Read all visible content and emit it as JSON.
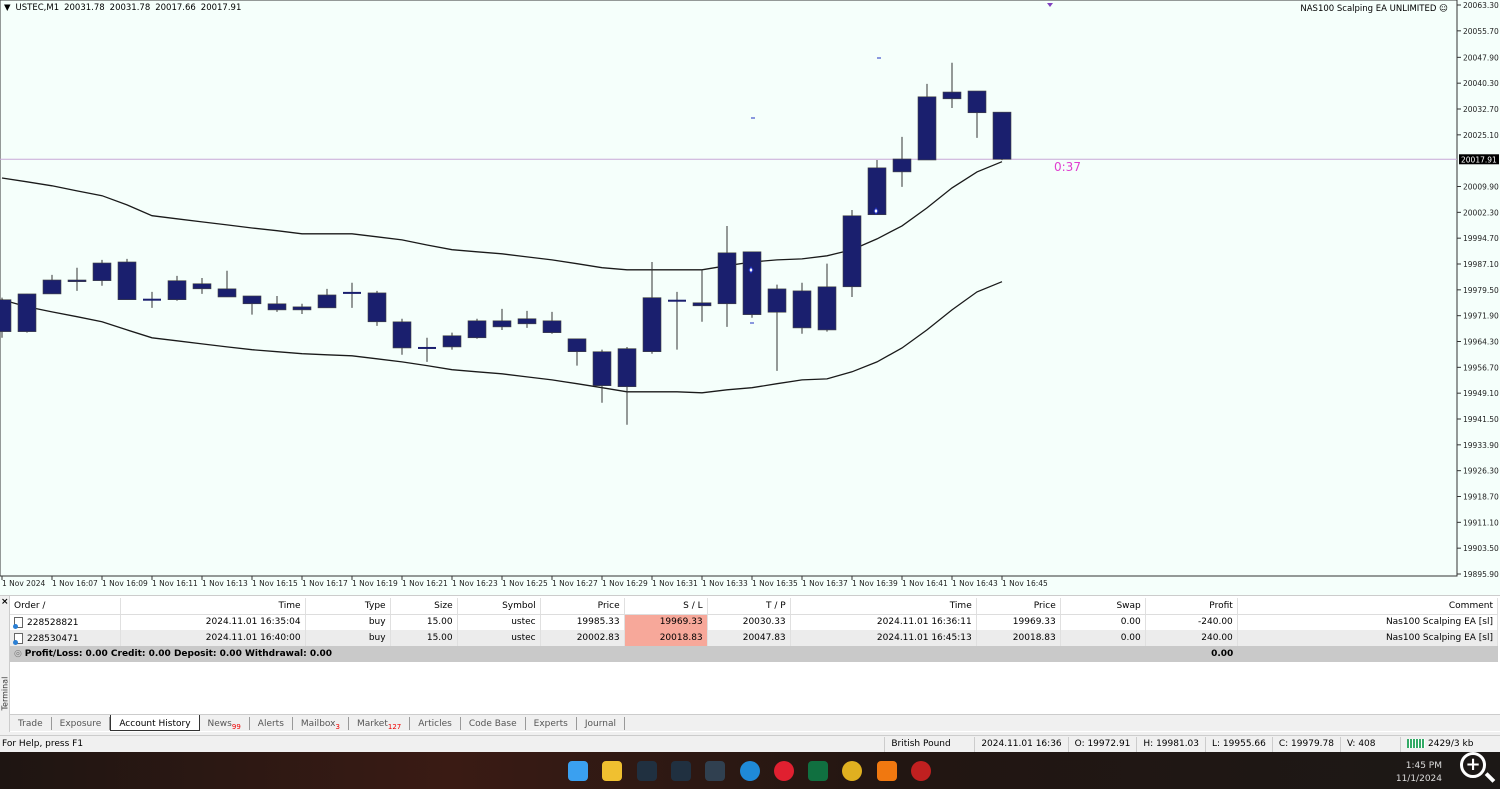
{
  "chart": {
    "symbol_header": "USTEC,M1",
    "header_ohlc": [
      "20031.78",
      "20031.78",
      "20017.66",
      "20017.91"
    ],
    "ea_label": "NAS100 Scalping EA UNLIMITED",
    "ea_icon": "smiley-icon",
    "current_price_label": "20017.91",
    "countdown": "0:37",
    "colors": {
      "background": "#f5fffb",
      "candle": "#1a1f6e",
      "bands": "#1a1a1a",
      "price_line": "#c8a8d8",
      "countdown": "#e040d0"
    }
  },
  "chart_data": {
    "type": "candlestick",
    "title": "USTEC,M1",
    "ylim": [
      19895.9,
      20063.3
    ],
    "y_ticks": [
      "20063.30",
      "20055.70",
      "20047.90",
      "20040.30",
      "20032.70",
      "20025.10",
      "20009.90",
      "20002.30",
      "19994.70",
      "19987.10",
      "19979.50",
      "19971.90",
      "19964.30",
      "19956.70",
      "19949.10",
      "19941.50",
      "19933.90",
      "19926.30",
      "19918.70",
      "19911.10",
      "19903.50",
      "19895.90"
    ],
    "x_tick_labels": [
      "1 Nov 2024",
      "1 Nov 16:07",
      "1 Nov 16:09",
      "1 Nov 16:11",
      "1 Nov 16:13",
      "1 Nov 16:15",
      "1 Nov 16:17",
      "1 Nov 16:19",
      "1 Nov 16:21",
      "1 Nov 16:23",
      "1 Nov 16:25",
      "1 Nov 16:27",
      "1 Nov 16:29",
      "1 Nov 16:31",
      "1 Nov 16:33",
      "1 Nov 16:35",
      "1 Nov 16:37",
      "1 Nov 16:39",
      "1 Nov 16:41",
      "1 Nov 16:43",
      "1 Nov 16:45"
    ],
    "candles": [
      [
        19967.2,
        19977.2,
        19965.4,
        19976.6
      ],
      [
        19967.2,
        19978.3,
        19966.9,
        19978.3
      ],
      [
        19978.3,
        19983.9,
        19978.3,
        19982.4
      ],
      [
        19981.9,
        19986.0,
        19979.2,
        19982.4
      ],
      [
        19982.2,
        19988.3,
        19980.7,
        19987.4
      ],
      [
        19987.7,
        19988.6,
        19976.6,
        19976.6
      ],
      [
        19976.6,
        19978.9,
        19974.2,
        19976.6
      ],
      [
        19976.6,
        19983.6,
        19976.3,
        19982.2
      ],
      [
        19981.3,
        19983.0,
        19978.3,
        19979.8
      ],
      [
        19979.8,
        19985.1,
        19977.4,
        19977.4
      ],
      [
        19977.7,
        19977.7,
        19972.2,
        19975.4
      ],
      [
        19975.4,
        19977.7,
        19973.0,
        19973.6
      ],
      [
        19973.6,
        19975.4,
        19972.4,
        19974.5
      ],
      [
        19974.2,
        19979.8,
        19974.2,
        19978.0
      ],
      [
        19978.6,
        19981.6,
        19974.2,
        19978.6
      ],
      [
        19978.6,
        19979.2,
        19968.9,
        19970.1
      ],
      [
        19970.1,
        19971.0,
        19960.4,
        19962.4
      ],
      [
        19962.4,
        19965.4,
        19958.3,
        19962.4
      ],
      [
        19962.7,
        19966.9,
        19961.9,
        19966.0
      ],
      [
        19965.4,
        19971.0,
        19965.1,
        19970.4
      ],
      [
        19968.6,
        19973.9,
        19967.7,
        19970.4
      ],
      [
        19969.5,
        19973.3,
        19968.3,
        19971.0
      ],
      [
        19970.4,
        19973.0,
        19966.6,
        19966.9
      ],
      [
        19965.1,
        19965.1,
        19957.2,
        19961.3
      ],
      [
        19961.3,
        19961.9,
        19946.3,
        19951.3
      ],
      [
        19951.0,
        19962.7,
        19939.8,
        19962.2
      ],
      [
        19961.3,
        19987.7,
        19960.7,
        19977.2
      ],
      [
        19976.3,
        19978.9,
        19961.9,
        19976.3
      ],
      [
        19975.7,
        19985.4,
        19970.1,
        19974.8
      ],
      [
        19975.4,
        19998.3,
        19968.6,
        19990.4
      ],
      [
        19990.7,
        19990.7,
        19971.3,
        19972.2
      ],
      [
        19972.91,
        19981.03,
        19955.66,
        19979.78
      ],
      [
        19979.2,
        19981.6,
        19966.6,
        19968.3
      ],
      [
        19967.7,
        19987.2,
        19967.2,
        19980.4
      ],
      [
        19980.4,
        20003.0,
        19977.4,
        20001.3
      ],
      [
        20001.6,
        20017.7,
        20001.6,
        20015.4
      ],
      [
        20014.2,
        20024.5,
        20009.8,
        20018.0
      ],
      [
        20017.7,
        20040.1,
        20017.7,
        20036.3
      ],
      [
        20035.7,
        20046.3,
        20033.0,
        20037.7
      ],
      [
        20038.0,
        20038.0,
        20024.2,
        20031.6
      ],
      [
        20031.78,
        20031.78,
        20017.66,
        20017.91
      ]
    ],
    "upper_band": [
      20012.4,
      20011.3,
      20010.1,
      20008.6,
      20007.2,
      20004.5,
      20001.3,
      20000.4,
      19999.5,
      19998.6,
      19997.7,
      19996.9,
      19996.0,
      19996.0,
      19996.0,
      19995.1,
      19994.2,
      19992.7,
      19991.3,
      19990.7,
      19990.1,
      19989.2,
      19988.3,
      19987.2,
      19986.0,
      19985.4,
      19985.4,
      19985.4,
      19985.4,
      19986.6,
      19987.7,
      19988.3,
      19988.6,
      19989.5,
      19991.3,
      19994.5,
      19998.3,
      20003.6,
      20009.5,
      20014.2,
      20017.2
    ],
    "lower_band": [
      19976.6,
      19974.5,
      19973.0,
      19971.6,
      19970.1,
      19967.7,
      19965.4,
      19964.5,
      19963.6,
      19962.7,
      19961.9,
      19961.3,
      19960.7,
      19960.4,
      19960.1,
      19959.2,
      19958.3,
      19957.2,
      19956.0,
      19955.4,
      19954.8,
      19953.9,
      19953.0,
      19951.9,
      19950.7,
      19949.5,
      19949.5,
      19949.5,
      19949.2,
      19950.1,
      19950.7,
      19951.9,
      19953.0,
      19953.3,
      19955.4,
      19958.3,
      19962.4,
      19967.7,
      19973.6,
      19978.9,
      19981.9
    ],
    "current_price": 20017.91,
    "grid": false
  },
  "terminal": {
    "side_label": "Terminal",
    "columns": [
      "Order",
      "Time",
      "Type",
      "Size",
      "Symbol",
      "Price",
      "S / L",
      "T / P",
      "Time",
      "Price",
      "Swap",
      "Profit",
      "Comment"
    ],
    "sort_indicator": "/",
    "rows": [
      [
        "228528821",
        "2024.11.01 16:35:04",
        "buy",
        "15.00",
        "ustec",
        "19985.33",
        "19969.33",
        "20030.33",
        "2024.11.01 16:36:11",
        "19969.33",
        "0.00",
        "-240.00",
        "Nas100 Scalping EA [sl]"
      ],
      [
        "228530471",
        "2024.11.01 16:40:00",
        "buy",
        "15.00",
        "ustec",
        "20002.83",
        "20018.83",
        "20047.83",
        "2024.11.01 16:45:13",
        "20018.83",
        "0.00",
        "240.00",
        "Nas100 Scalping EA [sl]"
      ]
    ],
    "summary": "Profit/Loss: 0.00  Credit: 0.00  Deposit: 0.00  Withdrawal: 0.00",
    "summary_profit": "0.00",
    "tabs": [
      {
        "label": "Trade"
      },
      {
        "label": "Exposure"
      },
      {
        "label": "Account History",
        "active": true
      },
      {
        "label": "News",
        "badge": "99"
      },
      {
        "label": "Alerts"
      },
      {
        "label": "Mailbox",
        "badge": "3"
      },
      {
        "label": "Market",
        "badge": "127"
      },
      {
        "label": "Articles"
      },
      {
        "label": "Code Base"
      },
      {
        "label": "Experts"
      },
      {
        "label": "Journal"
      }
    ]
  },
  "status": {
    "help": "For Help, press F1",
    "profile": "British Pound",
    "datetime": "2024.11.01 16:36",
    "open": "O: 19972.91",
    "high": "H: 19981.03",
    "low": "L: 19955.66",
    "close": "C: 19979.78",
    "volume": "V: 408",
    "traffic": "2429/3 kb"
  },
  "taskbar": {
    "time": "1:45 PM",
    "date": "11/1/2024",
    "icons": [
      "windows-start-icon",
      "file-explorer-icon",
      "metatrader-icon",
      "metatrader-icon",
      "app-icon",
      "edge-icon",
      "app-d-icon",
      "trading-app-icon",
      "chrome-icon",
      "vlc-icon",
      "recorder-icon"
    ]
  }
}
